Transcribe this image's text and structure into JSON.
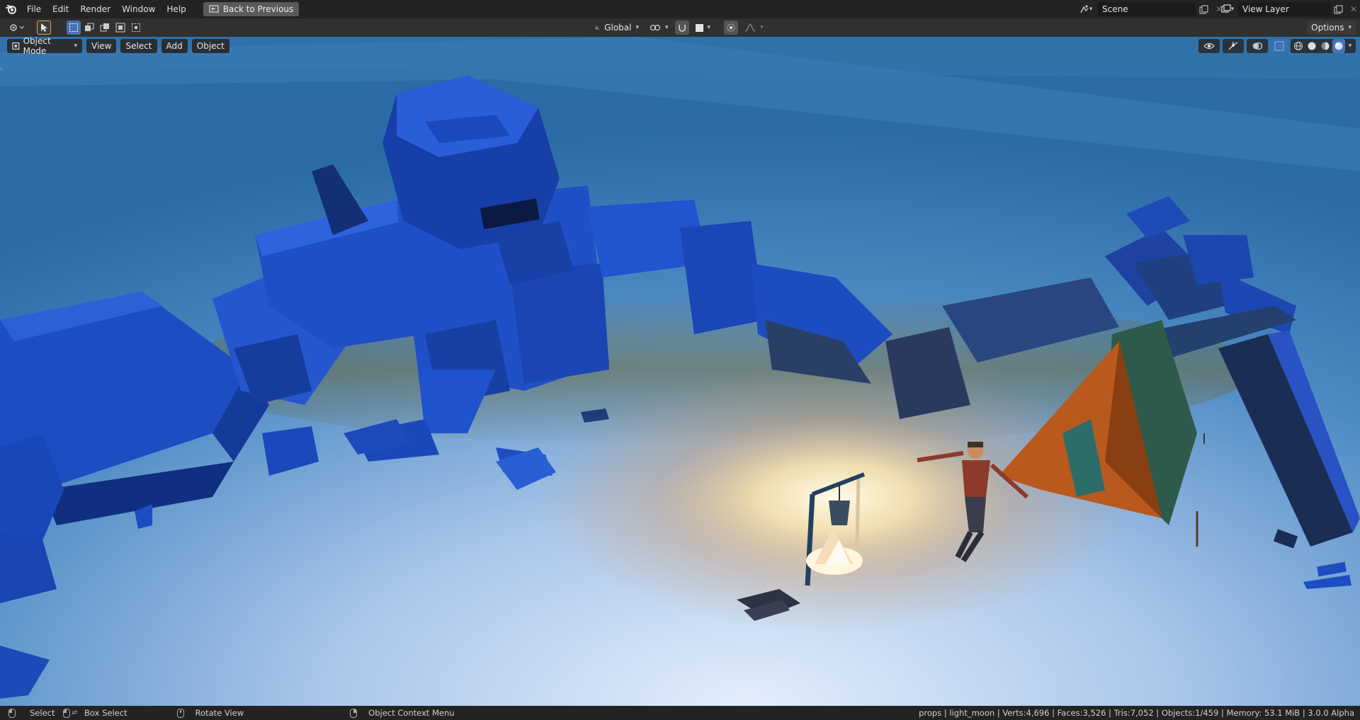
{
  "menu": {
    "items": [
      "File",
      "Edit",
      "Render",
      "Window",
      "Help"
    ],
    "back_button": "Back to Previous"
  },
  "scene_selector": {
    "value": "Scene"
  },
  "view_layer_selector": {
    "value": "View Layer"
  },
  "toolbar": {
    "transform_orientation": "Global",
    "options_label": "Options"
  },
  "viewport_header": {
    "mode": "Object Mode",
    "menus": [
      "View",
      "Select",
      "Add",
      "Object"
    ]
  },
  "statusbar": {
    "left": [
      {
        "icon": "mouse-left-icon",
        "label": "Select"
      },
      {
        "icon": "mouse-drag-icon",
        "label": "Box Select"
      },
      {
        "icon": "mouse-middle-icon",
        "label": "Rotate View"
      },
      {
        "icon": "mouse-right-icon",
        "label": "Object Context Menu"
      }
    ],
    "stats": "props | light_moon | Verts:4,696 | Faces:3,526 | Tris:7,052 | Objects:1/459 | Memory: 53.1 MiB | 3.0.0 Alpha"
  },
  "colors": {
    "viewport_bg": "#2b6ea6",
    "robot_blue": "#1f4fc4",
    "fire_glow": "#fff2c8",
    "tent_orange": "#b5581c",
    "active_tool": "#e8a53a"
  }
}
